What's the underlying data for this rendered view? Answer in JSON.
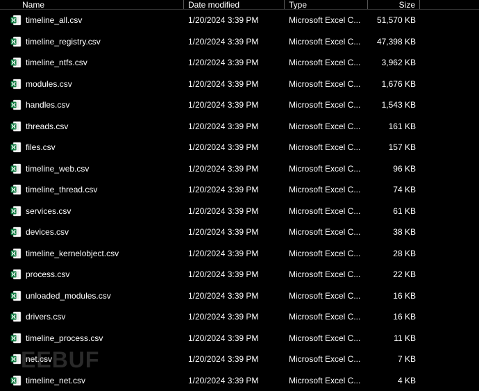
{
  "columns": {
    "name": "Name",
    "date": "Date modified",
    "type": "Type",
    "size": "Size"
  },
  "files": [
    {
      "name": "timeline_all.csv",
      "date": "1/20/2024 3:39 PM",
      "type": "Microsoft Excel C...",
      "size": "51,570 KB"
    },
    {
      "name": "timeline_registry.csv",
      "date": "1/20/2024 3:39 PM",
      "type": "Microsoft Excel C...",
      "size": "47,398 KB"
    },
    {
      "name": "timeline_ntfs.csv",
      "date": "1/20/2024 3:39 PM",
      "type": "Microsoft Excel C...",
      "size": "3,962 KB"
    },
    {
      "name": "modules.csv",
      "date": "1/20/2024 3:39 PM",
      "type": "Microsoft Excel C...",
      "size": "1,676 KB"
    },
    {
      "name": "handles.csv",
      "date": "1/20/2024 3:39 PM",
      "type": "Microsoft Excel C...",
      "size": "1,543 KB"
    },
    {
      "name": "threads.csv",
      "date": "1/20/2024 3:39 PM",
      "type": "Microsoft Excel C...",
      "size": "161 KB"
    },
    {
      "name": "files.csv",
      "date": "1/20/2024 3:39 PM",
      "type": "Microsoft Excel C...",
      "size": "157 KB"
    },
    {
      "name": "timeline_web.csv",
      "date": "1/20/2024 3:39 PM",
      "type": "Microsoft Excel C...",
      "size": "96 KB"
    },
    {
      "name": "timeline_thread.csv",
      "date": "1/20/2024 3:39 PM",
      "type": "Microsoft Excel C...",
      "size": "74 KB"
    },
    {
      "name": "services.csv",
      "date": "1/20/2024 3:39 PM",
      "type": "Microsoft Excel C...",
      "size": "61 KB"
    },
    {
      "name": "devices.csv",
      "date": "1/20/2024 3:39 PM",
      "type": "Microsoft Excel C...",
      "size": "38 KB"
    },
    {
      "name": "timeline_kernelobject.csv",
      "date": "1/20/2024 3:39 PM",
      "type": "Microsoft Excel C...",
      "size": "28 KB"
    },
    {
      "name": "process.csv",
      "date": "1/20/2024 3:39 PM",
      "type": "Microsoft Excel C...",
      "size": "22 KB"
    },
    {
      "name": "unloaded_modules.csv",
      "date": "1/20/2024 3:39 PM",
      "type": "Microsoft Excel C...",
      "size": "16 KB"
    },
    {
      "name": "drivers.csv",
      "date": "1/20/2024 3:39 PM",
      "type": "Microsoft Excel C...",
      "size": "16 KB"
    },
    {
      "name": "timeline_process.csv",
      "date": "1/20/2024 3:39 PM",
      "type": "Microsoft Excel C...",
      "size": "11 KB"
    },
    {
      "name": "net.csv",
      "date": "1/20/2024 3:39 PM",
      "type": "Microsoft Excel C...",
      "size": "7 KB"
    },
    {
      "name": "timeline_net.csv",
      "date": "1/20/2024 3:39 PM",
      "type": "Microsoft Excel C...",
      "size": "4 KB"
    }
  ],
  "watermark": "EEBUF",
  "icon_colors": {
    "excel_bg": "#107c41",
    "excel_page": "#ffffff"
  }
}
